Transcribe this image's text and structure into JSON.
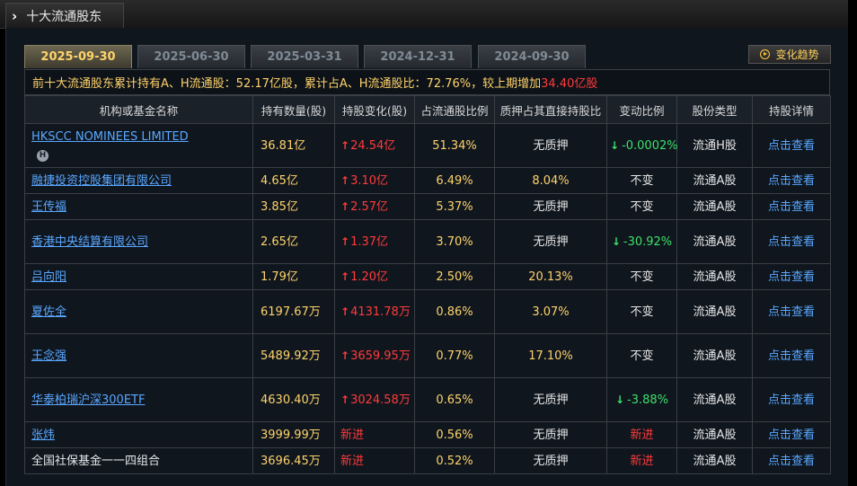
{
  "header": {
    "title": "十大流通股东"
  },
  "tabs": [
    "2025-09-30",
    "2025-06-30",
    "2025-03-31",
    "2024-12-31",
    "2024-09-30"
  ],
  "trend_button": "变化趋势",
  "summary": {
    "text_before": "前十大流通股东累计持有A、H流通股：52.17亿股，累计占A、H流通股比：72.76%，较上期增加",
    "increase": "34.40亿股"
  },
  "table": {
    "headers": [
      "机构或基金名称",
      "持有数量(股)",
      "持股变化(股)",
      "占流通股比例",
      "质押占其直接持股比",
      "变动比例",
      "股份类型",
      "持股详情"
    ],
    "rows": [
      {
        "name": "HKSCC NOMINEES LIMITED",
        "badge": "H",
        "link": true,
        "amount": "36.81亿",
        "change": "24.54亿",
        "change_dir": "up",
        "pct": "51.34%",
        "pledge": "无质押",
        "var": "-0.0002%",
        "var_dir": "down",
        "type": "流通H股",
        "detail": "点击查看"
      },
      {
        "name": "融捷投资控股集团有限公司",
        "link": true,
        "amount": "4.65亿",
        "change": "3.10亿",
        "change_dir": "up",
        "pct": "6.49%",
        "pledge": "8.04%",
        "var": "不变",
        "var_dir": "same",
        "type": "流通A股",
        "detail": "点击查看"
      },
      {
        "name": "王传福",
        "link": true,
        "amount": "3.85亿",
        "change": "2.57亿",
        "change_dir": "up",
        "pct": "5.37%",
        "pledge": "无质押",
        "var": "不变",
        "var_dir": "same",
        "type": "流通A股",
        "detail": "点击查看"
      },
      {
        "name": "香港中央结算有限公司",
        "link": true,
        "amount": "2.65亿",
        "change": "1.37亿",
        "change_dir": "up",
        "pct": "3.70%",
        "pledge": "无质押",
        "var": "-30.92%",
        "var_dir": "down",
        "type": "流通A股",
        "detail": "点击查看"
      },
      {
        "name": "吕向阳",
        "link": true,
        "amount": "1.79亿",
        "change": "1.20亿",
        "change_dir": "up",
        "pct": "2.50%",
        "pledge": "20.13%",
        "var": "不变",
        "var_dir": "same",
        "type": "流通A股",
        "detail": "点击查看"
      },
      {
        "name": "夏佐全",
        "link": true,
        "amount": "6197.67万",
        "change": "4131.78万",
        "change_dir": "up",
        "pct": "0.86%",
        "pledge": "3.07%",
        "var": "不变",
        "var_dir": "same",
        "type": "流通A股",
        "detail": "点击查看"
      },
      {
        "name": "王念强",
        "link": true,
        "amount": "5489.92万",
        "change": "3659.95万",
        "change_dir": "up",
        "pct": "0.77%",
        "pledge": "17.10%",
        "var": "不变",
        "var_dir": "same",
        "type": "流通A股",
        "detail": "点击查看"
      },
      {
        "name": "华泰柏瑞沪深300ETF",
        "link": true,
        "amount": "4630.40万",
        "change": "3024.58万",
        "change_dir": "up",
        "pct": "0.65%",
        "pledge": "无质押",
        "var": "-3.88%",
        "var_dir": "down",
        "type": "流通A股",
        "detail": "点击查看"
      },
      {
        "name": "张炜",
        "link": true,
        "amount": "3999.99万",
        "change": "新进",
        "change_dir": "new",
        "pct": "0.56%",
        "pledge": "无质押",
        "var": "新进",
        "var_dir": "new",
        "type": "流通A股",
        "detail": "点击查看"
      },
      {
        "name": "全国社保基金一一四组合",
        "link": false,
        "amount": "3696.45万",
        "change": "新进",
        "change_dir": "new",
        "pct": "0.52%",
        "pledge": "无质押",
        "var": "新进",
        "var_dir": "new",
        "type": "流通A股",
        "detail": "点击查看"
      }
    ]
  },
  "colors": {
    "accent": "#ffd36b",
    "up": "#ff3b3b",
    "down": "#3ee06a",
    "link": "#5aa7ff"
  }
}
